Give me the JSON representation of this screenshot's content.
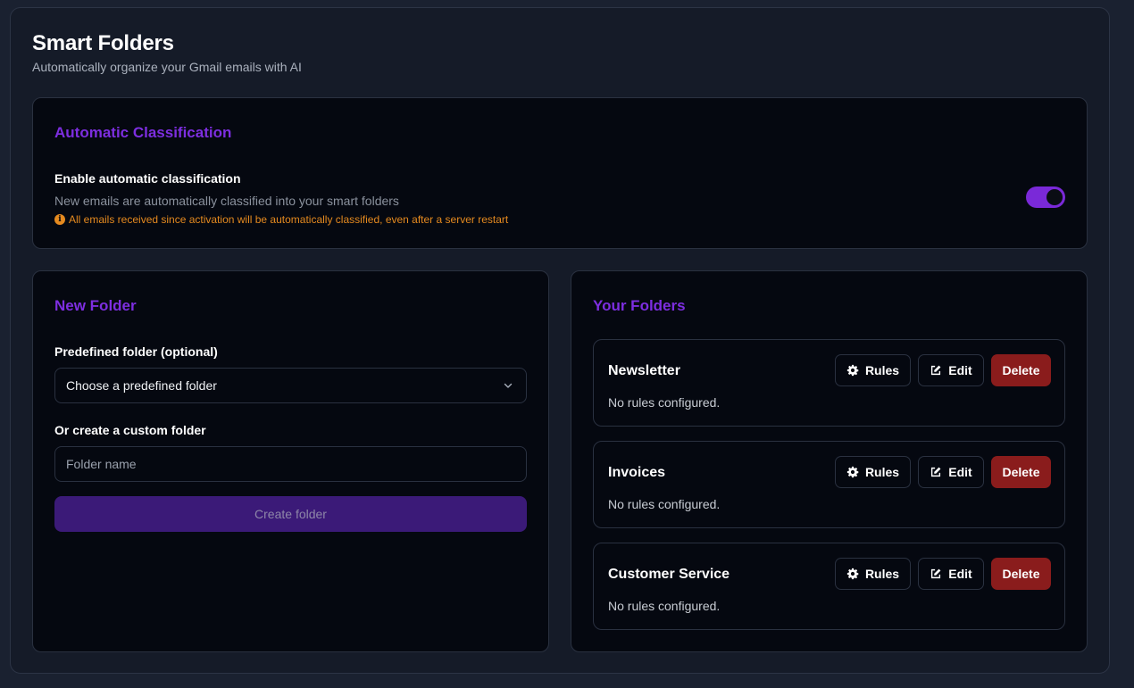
{
  "header": {
    "title": "Smart Folders",
    "subtitle": "Automatically organize your Gmail emails with AI"
  },
  "auto_classification": {
    "title": "Automatic Classification",
    "label": "Enable automatic classification",
    "description": "New emails are automatically classified into your smart folders",
    "warning": "All emails received since activation will be automatically classified, even after a server restart",
    "enabled": true,
    "accent_color": "#7a29d8"
  },
  "new_folder": {
    "title": "New Folder",
    "predefined_label": "Predefined folder (optional)",
    "predefined_value": "Choose a predefined folder",
    "custom_label": "Or create a custom folder",
    "name_placeholder": "Folder name",
    "create_label": "Create folder"
  },
  "your_folders": {
    "title": "Your Folders",
    "rules_label": "Rules",
    "edit_label": "Edit",
    "delete_label": "Delete",
    "delete_color": "#8a1c1c",
    "items": [
      {
        "name": "Newsletter",
        "rules_text": "No rules configured."
      },
      {
        "name": "Invoices",
        "rules_text": "No rules configured."
      },
      {
        "name": "Customer Service",
        "rules_text": "No rules configured."
      }
    ]
  },
  "icons": {
    "warning": "info-circle-icon",
    "chevron": "chevron-down-icon",
    "rules": "gear-icon",
    "edit": "edit-icon"
  }
}
